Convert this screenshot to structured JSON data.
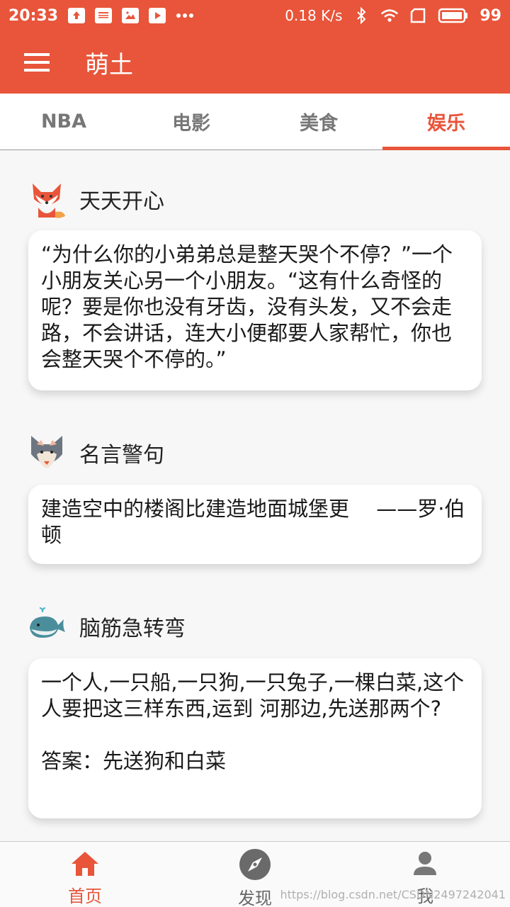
{
  "status_bar": {
    "time": "20:33",
    "speed": "0.18 K/s",
    "battery": "99",
    "icons": [
      "upload-icon",
      "news-icon",
      "image-icon",
      "video-icon",
      "more-icon",
      "bluetooth-icon",
      "wifi-icon",
      "sim-icon",
      "battery-icon"
    ]
  },
  "app_bar": {
    "title": "萌土",
    "menu_icon": "menu-icon"
  },
  "tabs": [
    {
      "label": "NBA",
      "active": false
    },
    {
      "label": "电影",
      "active": false
    },
    {
      "label": "美食",
      "active": false
    },
    {
      "label": "娱乐",
      "active": true
    }
  ],
  "sections": [
    {
      "title": "天天开心",
      "avatar": "fox-icon",
      "text": "“为什么你的小弟弟总是整天哭个不停？”一个小朋友关心另一个小朋友。“这有什么奇怪的呢？要是你也没有牙齿，没有头发，又不会走路，不会讲话，连大小便都要人家帮忙，你也会整天哭个不停的。”"
    },
    {
      "title": "名言警句",
      "avatar": "wolf-icon",
      "text": "建造空中的楼阁比建造地面城堡更　 ——罗·伯顿"
    },
    {
      "title": "脑筋急转弯",
      "avatar": "whale-icon",
      "text": "一个人,一只船,一只狗,一只兔子,一棵白菜,这个人要把这三样东西,运到 河那边,先送那两个?",
      "answer": "答案：先送狗和白菜"
    }
  ],
  "bottom_nav": [
    {
      "label": "首页",
      "icon": "home-icon",
      "active": true
    },
    {
      "label": "发现",
      "icon": "compass-icon",
      "active": false
    },
    {
      "label": "我",
      "icon": "person-icon",
      "active": false
    }
  ],
  "watermark": "https://blog.csdn.net/CSDN2497242041",
  "colors": {
    "primary": "#e8553a",
    "background": "#f7f7f7"
  }
}
